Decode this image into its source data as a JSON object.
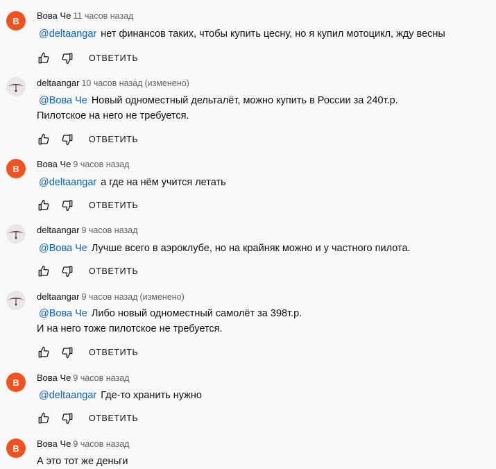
{
  "comments": [
    {
      "author": "Вова Че",
      "avatar_letter": "B",
      "time": "11 часов назад",
      "edited": "",
      "mention": "@deltaangar",
      "text_lines": [
        "нет финансов таких, чтобы купить цесну, но я купил мотоцикл, жду весны"
      ]
    },
    {
      "author": "deltaangar",
      "avatar_letter": "",
      "time": "10 часов назад",
      "edited": "(изменено)",
      "mention": "@Вова Че",
      "text_lines": [
        "Новый одноместный дельталёт, можно купить в России за 240т.р.",
        "Пилотское на него не требуется."
      ]
    },
    {
      "author": "Вова Че",
      "avatar_letter": "B",
      "time": "9 часов назад",
      "edited": "",
      "mention": "@deltaangar",
      "text_lines": [
        "а где на нём учится летать"
      ]
    },
    {
      "author": "deltaangar",
      "avatar_letter": "",
      "time": "9 часов назад",
      "edited": "",
      "mention": "@Вова Че",
      "text_lines": [
        "Лучше всего в аэроклубе, но на крайняк можно и у частного пилота."
      ]
    },
    {
      "author": "deltaangar",
      "avatar_letter": "",
      "time": "9 часов назад",
      "edited": "(изменено)",
      "mention": "@Вова Че",
      "text_lines": [
        "Либо новый одноместный самолёт за 398т.р.",
        "И на него тоже пилотское не требуется."
      ]
    },
    {
      "author": "Вова Че",
      "avatar_letter": "B",
      "time": "9 часов назад",
      "edited": "",
      "mention": "@deltaangar",
      "text_lines": [
        "Где-то хранить нужно"
      ]
    },
    {
      "author": "Вова Че",
      "avatar_letter": "B",
      "time": "9 часов назад",
      "edited": "",
      "mention": "",
      "text_lines": [
        "А это тот же деньги"
      ]
    }
  ],
  "reply_label": "ОТВЕТИТЬ",
  "icons": {
    "like": "thumb-up-icon",
    "dislike": "thumb-down-icon"
  },
  "colors": {
    "avatar_bg": "#f4511e",
    "mention": "#065fd4",
    "text": "#0f0f0f",
    "meta": "#606060",
    "background": "#f9f9f9"
  }
}
